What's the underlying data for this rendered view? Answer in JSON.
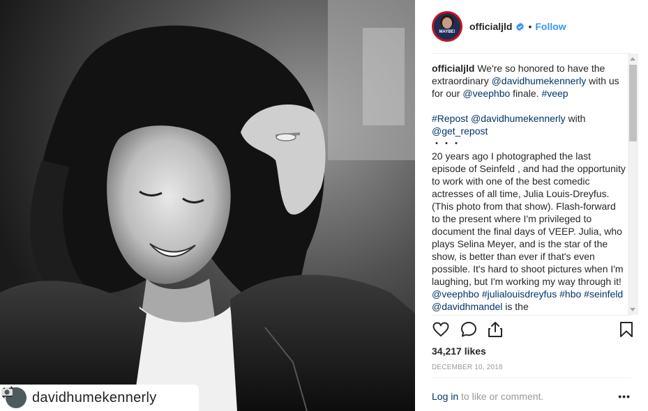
{
  "photo": {
    "repost_username": "davidhumekennerly",
    "repost_icon": "repost-icon"
  },
  "header": {
    "avatar_text": "MAYBE!",
    "username": "officialjld",
    "dot": "•",
    "follow_label": "Follow",
    "verified_icon": "verified-badge-icon"
  },
  "caption": {
    "username": "officialjld",
    "line1_text": " We're so honored to have the extraordinary ",
    "mention1": "@davidhumekennerly",
    "line1_text2": " with us for our ",
    "mention2": "@veephbo",
    "line1_text3": " finale. ",
    "hashtag1": "#veep",
    "repost_tag": "#Repost",
    "repost_space": " ",
    "repost_mention": "@davidhumekennerly",
    "repost_with": " with",
    "get_repost": "@get_repost",
    "bullets": "・・・",
    "body": "20 years ago I photographed the last episode of Seinfeld , and had the opportunity to work with one of the best comedic actresses of all time, Julia Louis-Dreyfus. (This photo from that show). Flash-forward to the present where I'm privileged to document the final days of VEEP. Julia, who plays Selina Meyer, and is the star of the show, is better than ever if that's even possible. It's hard to shoot pictures when I'm laughing, but I'm working my way through it! ",
    "tag_veephbo": "@veephbo",
    "tag_jld": "#julialouisdreyfus",
    "tag_hbo": "#hbo",
    "tag_seinfeld": "#seinfeld",
    "tag_dhm": "@davidhmandel",
    "tail": " is the"
  },
  "actions": {
    "like_icon": "heart-icon",
    "comment_icon": "comment-icon",
    "share_icon": "share-icon",
    "save_icon": "bookmark-icon"
  },
  "likes": "34,217 likes",
  "date": "DECEMBER 10, 2018",
  "footer": {
    "login": "Log in",
    "rest": " to like or comment.",
    "more": "•••"
  },
  "colors": {
    "link": "#003569",
    "follow": "#3897f0",
    "muted": "#999999"
  }
}
